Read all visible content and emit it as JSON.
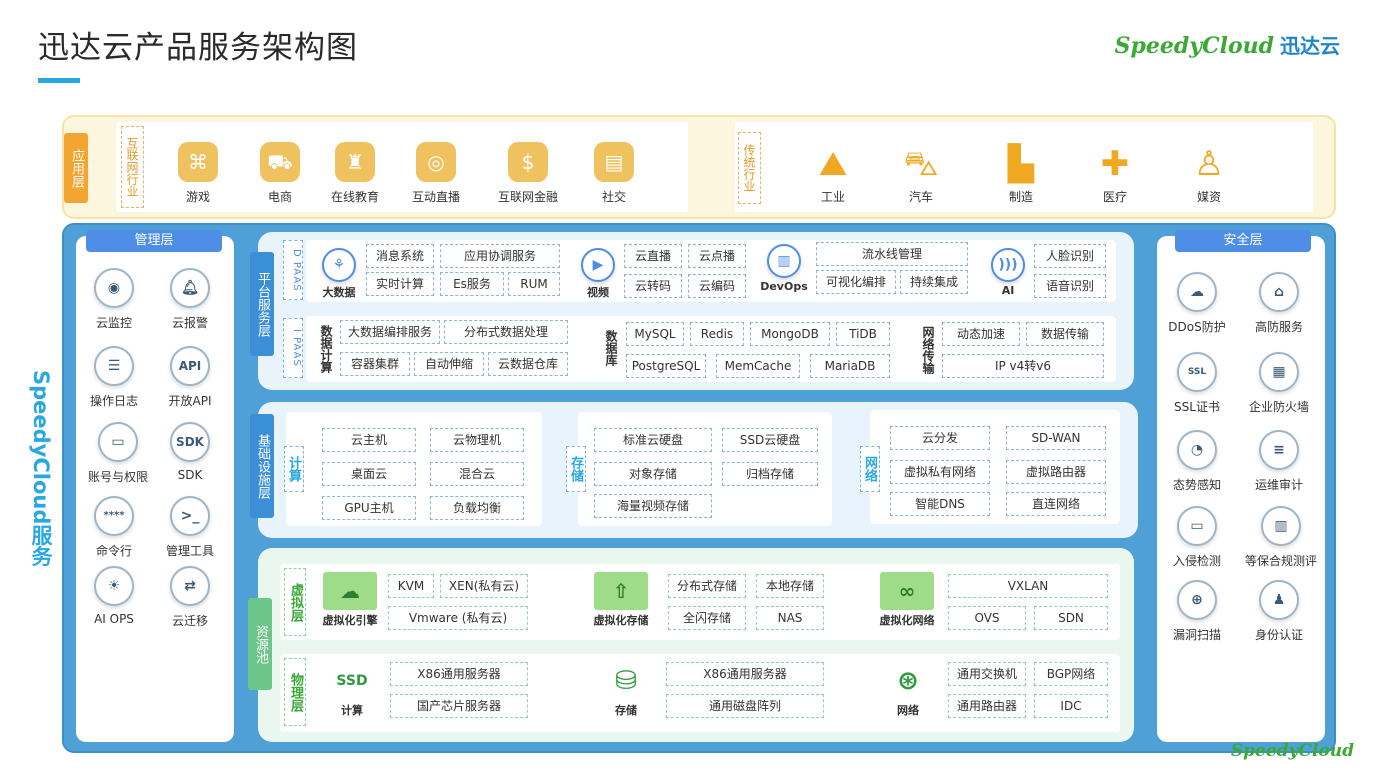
{
  "title": "迅达云产品服务架构图",
  "logo": {
    "en": "SpeedyCloud",
    "cn": "迅达云"
  },
  "bottom_logo": "SpeedyCloud",
  "side_text": "SpeedyCloud服务",
  "app_layer": {
    "tag": "应用层",
    "internet_label": "互联网行业",
    "internet_items": [
      "游戏",
      "电商",
      "在线教育",
      "互动直播",
      "互联网金融",
      "社交"
    ],
    "traditional_label": "传统行业",
    "traditional_items": [
      "工业",
      "汽车",
      "制造",
      "医疗",
      "媒资"
    ]
  },
  "management": {
    "title": "管理层",
    "items": [
      "云监控",
      "云报警",
      "操作日志",
      "开放API",
      "账号与权限",
      "SDK",
      "命令行",
      "管理工具",
      "AI OPS",
      "云迁移"
    ]
  },
  "security": {
    "title": "安全层",
    "items": [
      "DDoS防护",
      "高防服务",
      "SSL证书",
      "企业防火墙",
      "态势感知",
      "运维审计",
      "入侵检测",
      "等保合规测评",
      "漏洞扫描",
      "身份认证"
    ]
  },
  "platform": {
    "tag": "平台服务层",
    "dpaas": "D PAAS",
    "ipaas": "I PAAS",
    "bigdata": {
      "label": "大数据",
      "items": [
        "消息系统",
        "应用协调服务",
        "实时计算",
        "Es服务",
        "RUM"
      ]
    },
    "video": {
      "label": "视频",
      "items": [
        "云直播",
        "云点播",
        "云转码",
        "云编码"
      ]
    },
    "devops": {
      "label": "DevOps",
      "items": [
        "流水线管理",
        "可视化编排",
        "持续集成"
      ]
    },
    "ai": {
      "label": "AI",
      "items": [
        "人脸识别",
        "语音识别"
      ]
    },
    "data_compute": {
      "label": "数据计算",
      "items": [
        "大数据编排服务",
        "分布式数据处理",
        "容器集群",
        "自动伸缩",
        "云数据仓库"
      ]
    },
    "database": {
      "label": "数据库",
      "items": [
        "MySQL",
        "Redis",
        "MongoDB",
        "TiDB",
        "PostgreSQL",
        "MemCache",
        "MariaDB"
      ]
    },
    "network": {
      "label": "网络传输",
      "items": [
        "动态加速",
        "数据传输",
        "IP v4转v6"
      ]
    }
  },
  "infra": {
    "tag": "基础设施层",
    "compute": {
      "label": "计算",
      "items": [
        "云主机",
        "云物理机",
        "桌面云",
        "混合云",
        "GPU主机",
        "负载均衡"
      ]
    },
    "storage": {
      "label": "存储",
      "items": [
        "标准云硬盘",
        "SSD云硬盘",
        "对象存储",
        "归档存储",
        "海量视频存储"
      ]
    },
    "network": {
      "label": "网络",
      "items": [
        "云分发",
        "SD-WAN",
        "虚拟私有网络",
        "虚拟路由器",
        "智能DNS",
        "直连网络"
      ]
    }
  },
  "resource": {
    "tag": "资源池",
    "virtual_label": "虚拟层",
    "physical_label": "物理层",
    "v_engine": {
      "label": "虚拟化引擎",
      "items": [
        "KVM",
        "XEN(私有云)",
        "Vmware (私有云)"
      ]
    },
    "v_storage": {
      "label": "虚拟化存储",
      "items": [
        "分布式存储",
        "本地存储",
        "全闪存储",
        "NAS"
      ]
    },
    "v_network": {
      "label": "虚拟化网络",
      "items": [
        "VXLAN",
        "OVS",
        "SDN"
      ]
    },
    "p_compute": {
      "label": "计算",
      "items": [
        "X86通用服务器",
        "国产芯片服务器"
      ]
    },
    "p_storage": {
      "label": "存储",
      "items": [
        "X86通用服务器",
        "通用磁盘阵列"
      ]
    },
    "p_network": {
      "label": "网络",
      "items": [
        "通用交换机",
        "BGP网络",
        "通用路由器",
        "IDC"
      ]
    }
  }
}
